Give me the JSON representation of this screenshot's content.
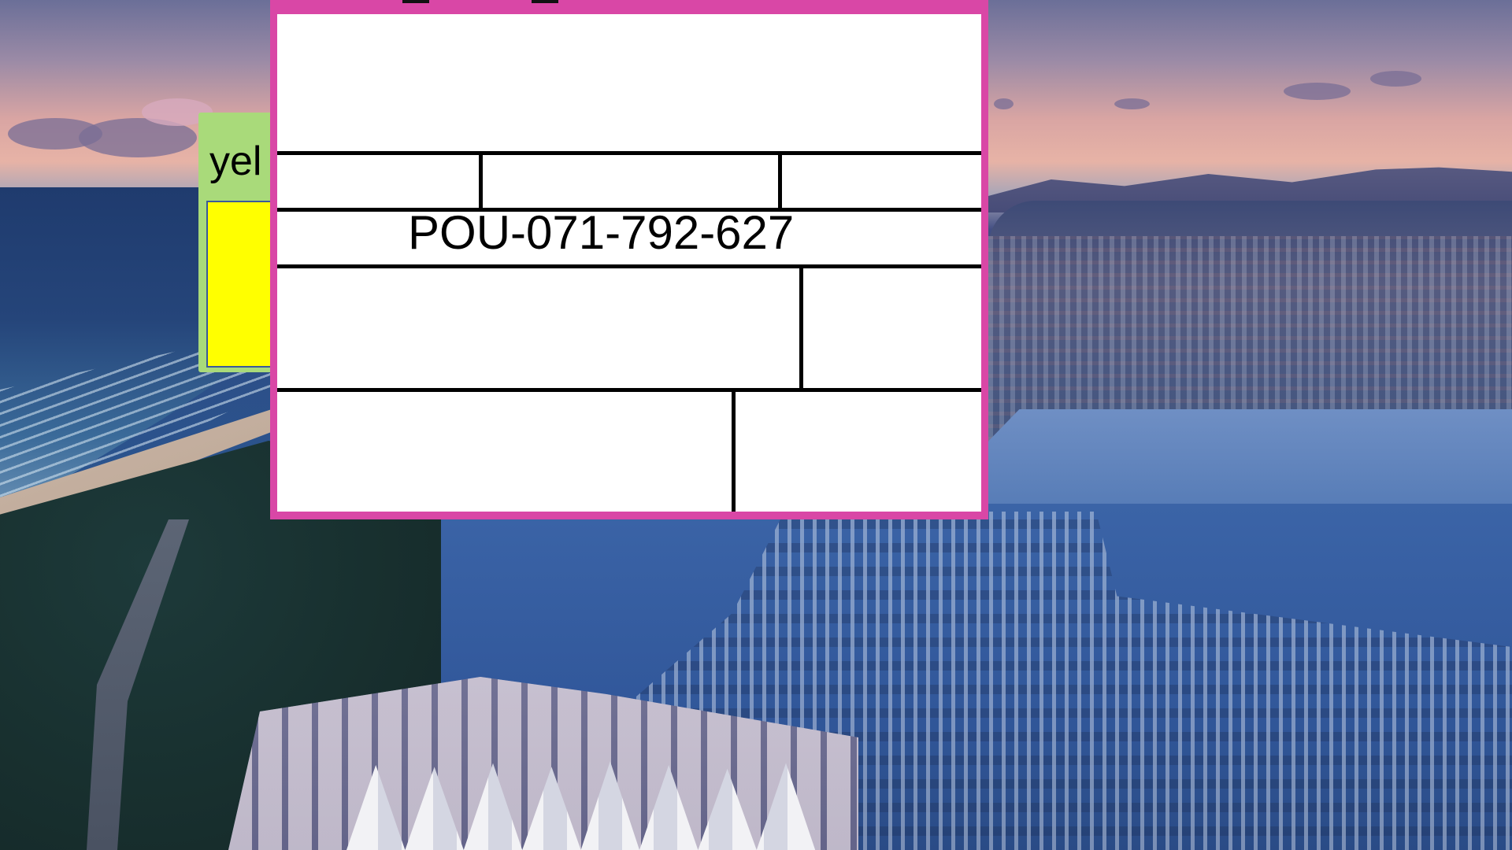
{
  "desktop": {
    "background_description": ""
  },
  "green_window": {
    "label": "yel",
    "background_color": "#a9da7a",
    "swatch_color": "#ffff00"
  },
  "pink_window": {
    "frame_color": "#d947a6",
    "code": "POU-071-792-627"
  }
}
